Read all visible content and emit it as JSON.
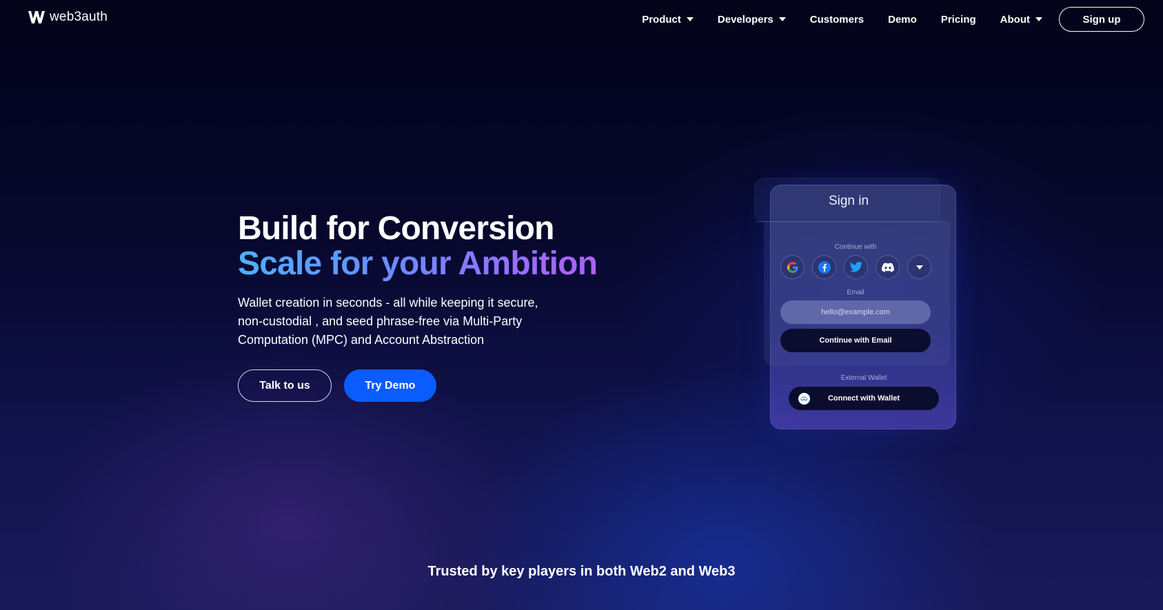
{
  "brand": {
    "name": "web3auth",
    "logo_icon": "w-logo-icon"
  },
  "nav": {
    "items": [
      {
        "label": "Product",
        "dropdown": true
      },
      {
        "label": "Developers",
        "dropdown": true
      },
      {
        "label": "Customers",
        "dropdown": false
      },
      {
        "label": "Demo",
        "dropdown": false
      },
      {
        "label": "Pricing",
        "dropdown": false
      },
      {
        "label": "About",
        "dropdown": true
      }
    ],
    "signup_label": "Sign up"
  },
  "hero": {
    "headline_line1": "Build for Conversion",
    "headline_line2": "Scale for your Ambition",
    "subtext": "Wallet creation in seconds - all while keeping it secure, non-custodial , and seed phrase-free via Multi-Party Computation (MPC) and Account Abstraction",
    "cta_secondary": "Talk to us",
    "cta_primary": "Try Demo"
  },
  "signin_card": {
    "title": "Sign in",
    "continue_with_label": "Continue with",
    "socials": [
      "google-icon",
      "facebook-icon",
      "twitter-icon",
      "discord-icon",
      "more-chevron-icon"
    ],
    "email_label": "Email",
    "email_placeholder": "hello@example.com",
    "continue_email_label": "Continue with Email",
    "external_wallet_label": "External Wallet",
    "connect_wallet_label": "Connect with Wallet"
  },
  "trusted_text": "Trusted by key players in both Web2 and Web3",
  "colors": {
    "primary_button": "#0a5cff",
    "gradient_start": "#4fb0ff",
    "gradient_end": "#b35cf0",
    "background": "#03031a"
  }
}
